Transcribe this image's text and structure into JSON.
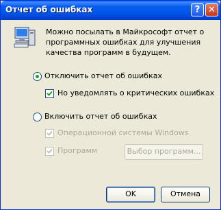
{
  "window": {
    "title": "Отчет об ошибках",
    "help_glyph": "?",
    "close_glyph": "✕"
  },
  "info_text": "Можно посылать в Майкрософт отчет о программных ошибках для улучшения качества программ в будущем.",
  "options": {
    "disable_label": "Отключить отчет об ошибках",
    "disable_selected": true,
    "notify_critical_label": "Но уведомлять о критических ошибках",
    "notify_critical_checked": true,
    "enable_label": "Включить отчет об ошибках",
    "enable_selected": false,
    "os_label": "Операционной системы Windows",
    "os_checked": true,
    "programs_label": "Программ",
    "programs_checked": true,
    "choose_programs_label": "Выбор программ..."
  },
  "buttons": {
    "ok": "OK",
    "cancel": "Отмена"
  },
  "colors": {
    "title_blue": "#0058ee",
    "dialog_bg": "#ece9d8",
    "radio_dot": "#21a121",
    "disabled_text": "#aca899"
  }
}
